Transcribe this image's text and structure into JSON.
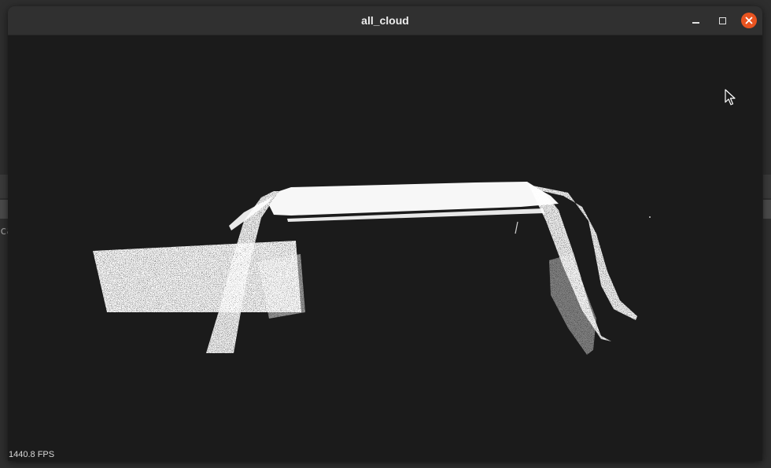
{
  "window": {
    "title": "all_cloud",
    "buttons": {
      "minimize": "minimize-icon",
      "maximize": "maximize-icon",
      "close": "close-icon"
    },
    "close_color": "#e95420"
  },
  "background_app": {
    "visible_text": "ca"
  },
  "viewer": {
    "background_color": "#1b1b1b",
    "point_color": "#ffffff",
    "fps_text": "1440.8 FPS"
  }
}
